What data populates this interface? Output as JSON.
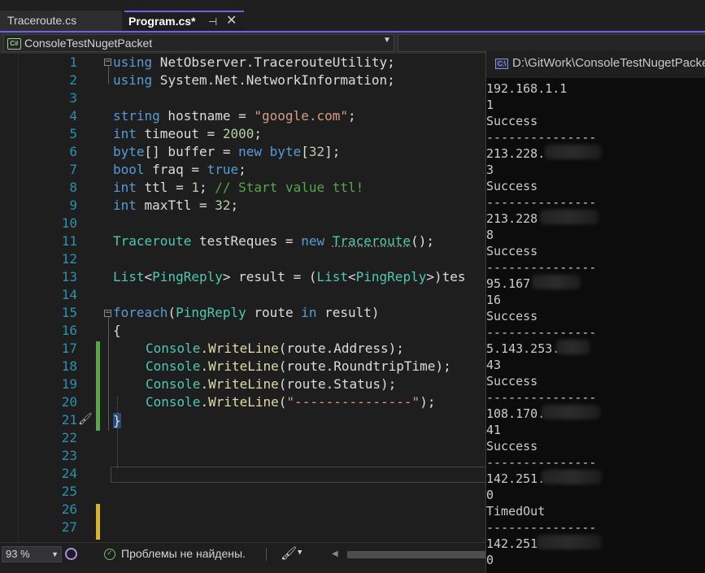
{
  "tabs": [
    {
      "label": "Traceroute.cs",
      "active": false
    },
    {
      "label": "Program.cs*",
      "active": true
    }
  ],
  "tab_icons": {
    "pin": "pin-icon",
    "close": "close-icon"
  },
  "project_dropdown": {
    "value": "ConsoleTestNugetPacket",
    "icon": "csharp-project-icon"
  },
  "editor": {
    "line_numbers": [
      "1",
      "2",
      "3",
      "4",
      "5",
      "6",
      "7",
      "8",
      "9",
      "10",
      "11",
      "12",
      "13",
      "14",
      "15",
      "16",
      "17",
      "18",
      "19",
      "20",
      "21",
      "22",
      "23",
      "24",
      "25",
      "26",
      "27"
    ],
    "code": {
      "l1": [
        "using",
        " NetObserver.TracerouteUtility;"
      ],
      "l2": [
        "using",
        " System.Net.NetworkInformation;"
      ],
      "l4": [
        "string",
        " hostname = ",
        "\"google.com\"",
        ";"
      ],
      "l5": [
        "int",
        " timeout = ",
        "2000",
        ";"
      ],
      "l6": [
        "byte",
        "[] buffer = ",
        "new",
        " ",
        "byte",
        "[",
        "32",
        "];"
      ],
      "l7": [
        "bool",
        " fraq = ",
        "true",
        ";"
      ],
      "l8": [
        "int",
        " ttl = ",
        "1",
        "; ",
        "// Start value ttl!"
      ],
      "l9": [
        "int",
        " maxTtl = ",
        "32",
        ";"
      ],
      "l11": [
        "Traceroute",
        " testReques = ",
        "new",
        " ",
        "Traceroute",
        "();"
      ],
      "l13": [
        "List",
        "<",
        "PingReply",
        "> result = (",
        "List",
        "<",
        "PingReply",
        ">)tes"
      ],
      "l15": [
        "foreach",
        "(",
        "PingReply",
        " route ",
        "in",
        " result)"
      ],
      "l16": "{",
      "l17": [
        "Console",
        ".",
        "WriteLine",
        "(route.Address);"
      ],
      "l18": [
        "Console",
        ".",
        "WriteLine",
        "(route.RoundtripTime);"
      ],
      "l19": [
        "Console",
        ".",
        "WriteLine",
        "(route.Status);"
      ],
      "l20": [
        "Console",
        ".",
        "WriteLine",
        "(",
        "\"---------------\"",
        ");"
      ],
      "l21": "}"
    }
  },
  "console": {
    "title": "D:\\GitWork\\ConsoleTestNugetPacke",
    "icon": "console-window-icon",
    "lines": [
      "192.168.1.1",
      "1",
      "Success",
      "---------------",
      "213.228.",
      "3",
      "Success",
      "---------------",
      "213.228",
      "8",
      "Success",
      "---------------",
      "95.167",
      "16",
      "Success",
      "---------------",
      "5.143.253.",
      "43",
      "Success",
      "---------------",
      "108.170.",
      "41",
      "Success",
      "---------------",
      "142.251.",
      "0",
      "TimedOut",
      "---------------",
      "142.251",
      "0"
    ]
  },
  "statusbar": {
    "zoom": "93 %",
    "issues": "Проблемы не найдены.",
    "icons": [
      "copilot-icon",
      "check-circle-icon",
      "brush-icon"
    ]
  },
  "colors": {
    "accent": "#7160e8",
    "keyword": "#569cd6",
    "type": "#4ec9b0",
    "string": "#d69d85",
    "number": "#b5cea8",
    "comment": "#57a64a",
    "method": "#dcdcaa",
    "line_number": "#2b91af",
    "change_saved": "#57a64a",
    "change_unsaved": "#d8b428"
  }
}
